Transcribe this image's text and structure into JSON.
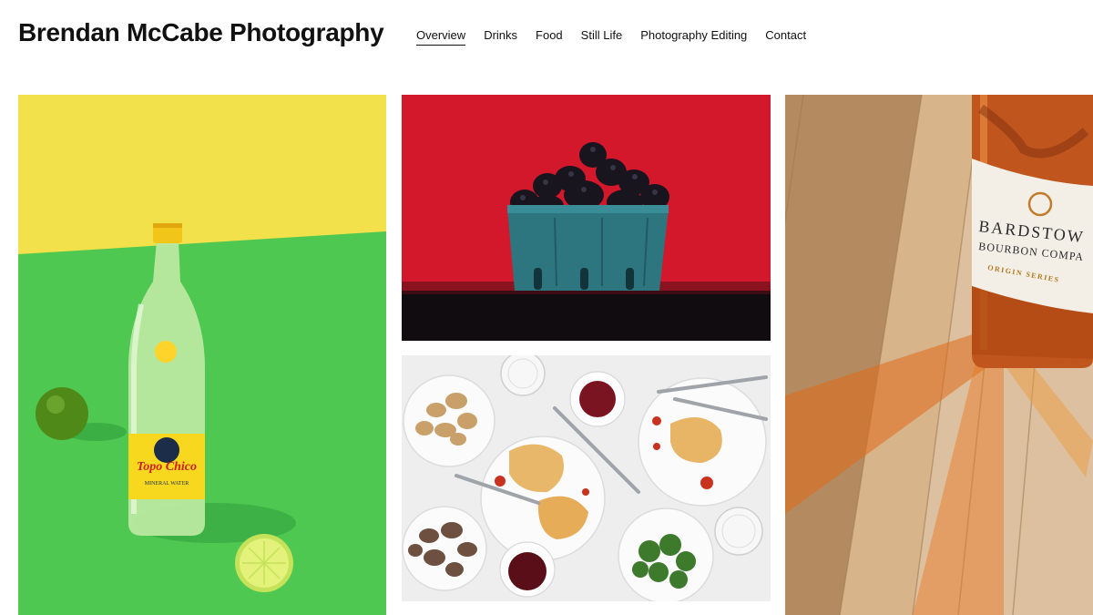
{
  "site": {
    "title": "Brendan McCabe Photography"
  },
  "nav": {
    "items": [
      {
        "label": "Overview",
        "active": true
      },
      {
        "label": "Drinks"
      },
      {
        "label": "Food"
      },
      {
        "label": "Still Life"
      },
      {
        "label": "Photography Editing"
      },
      {
        "label": "Contact"
      }
    ]
  },
  "gallery": {
    "tiles": [
      {
        "subject": "topo-chico-bottle-with-limes",
        "label": {
          "brand": "Topo Chico",
          "sub": "MINERAL WATER"
        },
        "colors": {
          "top": "#f2e14a",
          "bottom": "#4fc852"
        }
      },
      {
        "subject": "blackberries-in-teal-carton",
        "colors": {
          "background": "#d4182c",
          "carton": "#2d7680"
        }
      },
      {
        "subject": "chicken-parmesan-dinner-spread",
        "colors": {
          "background": "#eeeeee"
        }
      },
      {
        "subject": "bardstown-bourbon-bottle-on-wood",
        "label": {
          "brand": "BARDSTOW",
          "line2": "BOURBON COMPA",
          "line3": "ORIGIN SERIES"
        },
        "colors": {
          "wood": "#c9a177",
          "bourbon": "#c0561e"
        }
      }
    ]
  }
}
